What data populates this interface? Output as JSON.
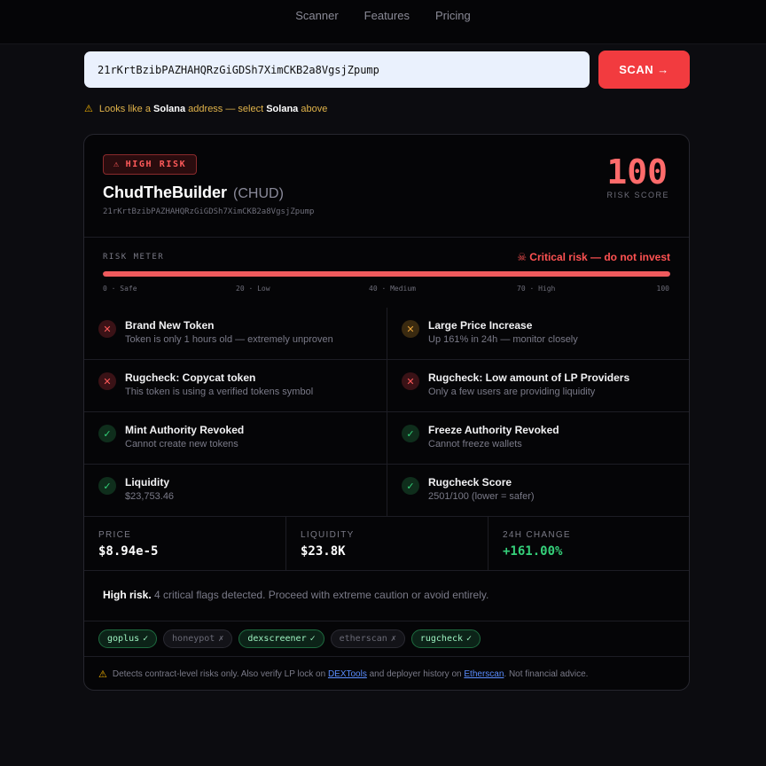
{
  "nav": {
    "items": [
      "Scanner",
      "Features",
      "Pricing"
    ]
  },
  "scan": {
    "address_value": "21rKrtBzibPAZHAHQRzGiGDSh7XimCKB2a8VgsjZpump",
    "button_label": "SCAN →",
    "hint_pre": "Looks like a",
    "hint_chain": "Solana",
    "hint_mid": "address — select",
    "hint_chain2": "Solana",
    "hint_post": "above"
  },
  "token": {
    "badge": "HIGH RISK",
    "name": "ChudTheBuilder",
    "symbol": "(CHUD)",
    "address": "21rKrtBzibPAZHAHQRzGiGDSh7XimCKB2a8VgsjZpump",
    "risk_score": "100",
    "risk_score_label": "RISK SCORE"
  },
  "meter": {
    "label": "RISK METER",
    "verdict": "☠ Critical risk — do not invest",
    "value_pct": 100,
    "ticks": [
      "0 · Safe",
      "20 · Low",
      "40 · Medium",
      "70 · High",
      "100"
    ]
  },
  "checks": [
    {
      "title": "Brand New Token",
      "sub": "Token is only 1 hours old — extremely unproven",
      "status": "bad"
    },
    {
      "title": "Large Price Increase",
      "sub": "Up 161% in 24h — monitor closely",
      "status": "warn"
    },
    {
      "title": "Rugcheck: Copycat token",
      "sub": "This token is using a verified tokens symbol",
      "status": "bad"
    },
    {
      "title": "Rugcheck: Low amount of LP Providers",
      "sub": "Only a few users are providing liquidity",
      "status": "bad"
    },
    {
      "title": "Mint Authority Revoked",
      "sub": "Cannot create new tokens",
      "status": "ok"
    },
    {
      "title": "Freeze Authority Revoked",
      "sub": "Cannot freeze wallets",
      "status": "ok"
    },
    {
      "title": "Liquidity",
      "sub": "$23,753.46",
      "status": "ok"
    },
    {
      "title": "Rugcheck Score",
      "sub": "2501/100 (lower = safer)",
      "status": "ok"
    }
  ],
  "stats": [
    {
      "label": "PRICE",
      "value": "$8.94e-5"
    },
    {
      "label": "LIQUIDITY",
      "value": "$23.8K"
    },
    {
      "label": "24H CHANGE",
      "value": "+161.00%"
    }
  ],
  "summary": {
    "bold": "High risk.",
    "text": "4 critical flags detected. Proceed with extreme caution or avoid entirely."
  },
  "sources": [
    {
      "name": "goplus",
      "mark": "✓",
      "on": true
    },
    {
      "name": "honeypot",
      "mark": "✗",
      "on": false
    },
    {
      "name": "dexscreener",
      "mark": "✓",
      "on": true
    },
    {
      "name": "etherscan",
      "mark": "✗",
      "on": false
    },
    {
      "name": "rugcheck",
      "mark": "✓",
      "on": true
    }
  ],
  "footer": {
    "pre": "Detects contract-level risks only. Also verify LP lock on",
    "link1": "DEXTools",
    "mid": "and deployer history on",
    "link2": "Etherscan",
    "post": ". Not financial advice."
  },
  "colors": {
    "accent": "#f23b3f",
    "danger": "#ff5a5a",
    "ok": "#34d27a",
    "warn": "#e8a33a"
  }
}
